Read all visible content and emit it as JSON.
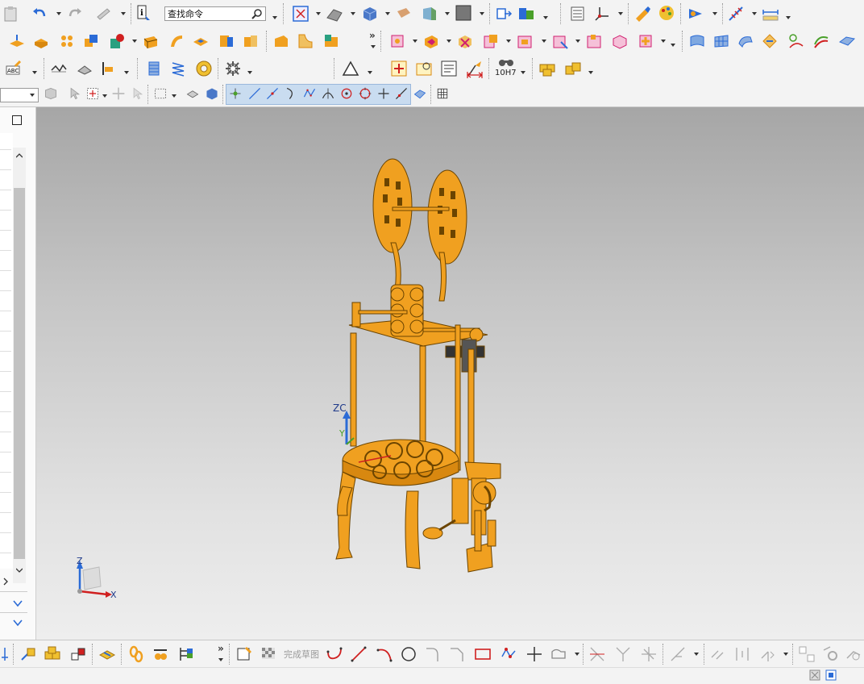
{
  "toolbar": {
    "search_placeholder": "查找命令",
    "finish_sketch": "完成草图",
    "tolerance_label": "10H7",
    "overflow": "»"
  },
  "view": {
    "wcs_label": "ZC",
    "wcs_y_label": "Y",
    "triad_z": "Z",
    "triad_x": "X"
  },
  "colors": {
    "model": "#f0a020",
    "model_dark": "#6b4400",
    "accent_blue": "#2b6bd6",
    "accent_orange": "#f0a020",
    "accent_green": "#4aa02a"
  },
  "icons": [
    "paste-icon",
    "undo-icon",
    "redo-icon",
    "brush-icon",
    "info-icon",
    "search-icon",
    "fit-icon",
    "shaded-icon",
    "cube-icon",
    "layer-icon",
    "window-icon",
    "measure-icon",
    "sketch-icon",
    "extrude-icon",
    "revolve-icon",
    "hole-icon",
    "blend-icon",
    "chamfer-icon",
    "pattern-icon",
    "spring-icon",
    "gear-icon",
    "bearing-icon",
    "datum-icon",
    "table-icon",
    "note-icon",
    "dimension-icon",
    "select-icon",
    "snap-icon",
    "line-icon",
    "arc-icon",
    "circle-icon",
    "rectangle-icon",
    "polygon-icon",
    "point-icon",
    "trim-icon",
    "constraint-icon"
  ]
}
